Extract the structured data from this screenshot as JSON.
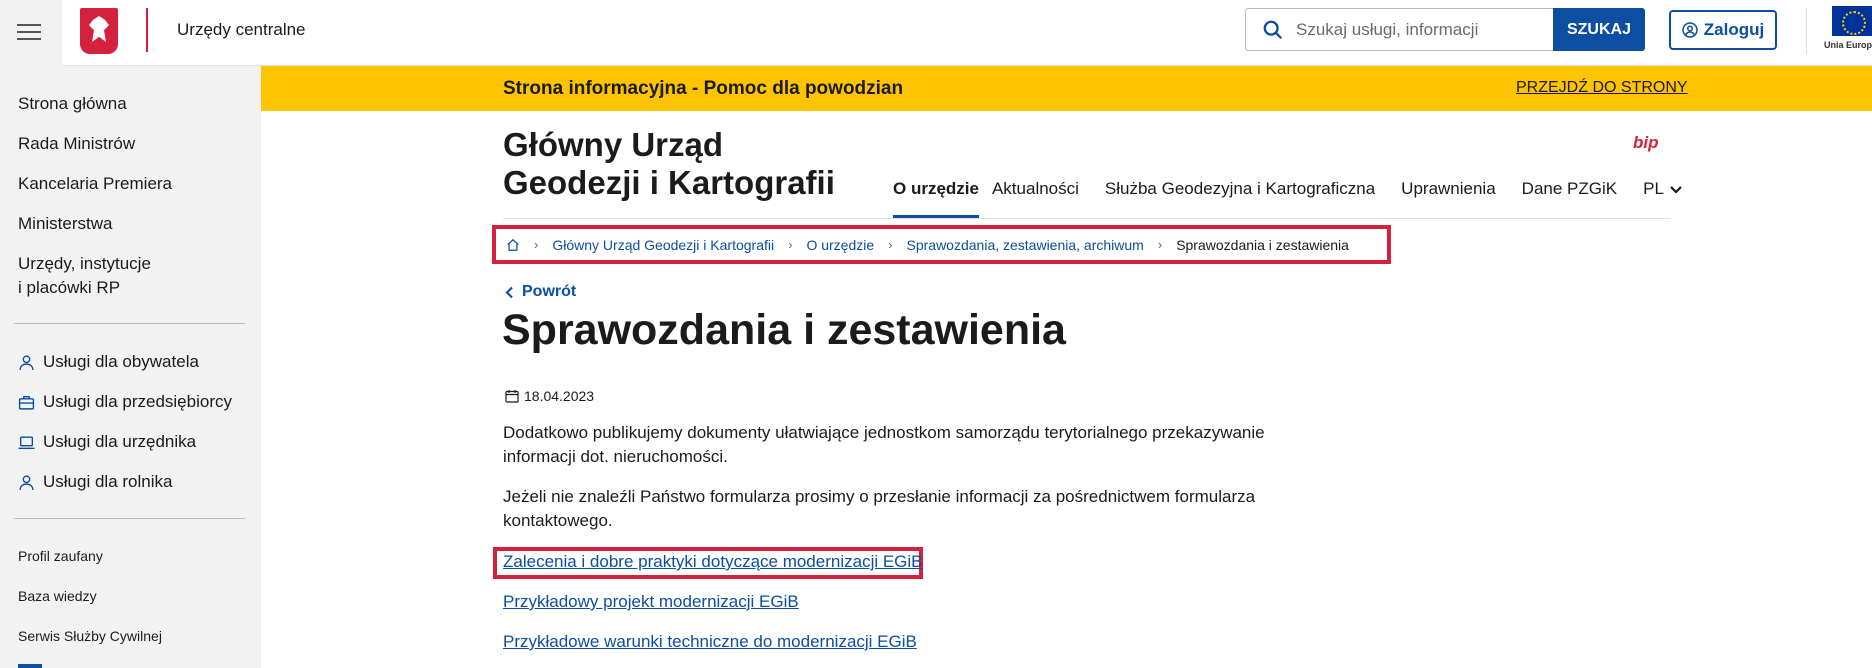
{
  "header": {
    "site_name": "Urzędy centralne",
    "search_placeholder": "Szukaj usługi, informacji",
    "search_button": "SZUKAJ",
    "login_button": "Zaloguj",
    "eu_label": "Unia Europ"
  },
  "sidebar": {
    "main_items": [
      "Strona główna",
      "Rada Ministrów",
      "Kancelaria Premiera",
      "Ministerstwa",
      "Urzędy, instytucje",
      "i placówki RP"
    ],
    "service_items": [
      {
        "label": "Usługi dla obywatela",
        "icon": "person-icon"
      },
      {
        "label": "Usługi dla przedsiębiorcy",
        "icon": "briefcase-icon"
      },
      {
        "label": "Usługi dla urzędnika",
        "icon": "laptop-icon"
      },
      {
        "label": "Usługi dla rolnika",
        "icon": "person-icon"
      }
    ],
    "small_items": [
      "Profil zaufany",
      "Baza wiedzy",
      "Serwis Służby Cywilnej"
    ]
  },
  "banner": {
    "text": "Strona informacyjna - Pomoc dla powodzian",
    "link": "PRZEJDŹ DO STRONY"
  },
  "institution": {
    "name_line1": "Główny Urząd",
    "name_line2": "Geodezji i Kartografii",
    "bip": "bip"
  },
  "nav": {
    "items": [
      "O urzędzie",
      "Aktualności",
      "Służba Geodezyjna i Kartograficzna",
      "Uprawnienia",
      "Dane PZGiK",
      "PL"
    ]
  },
  "breadcrumb": {
    "links": [
      "Główny Urząd Geodezji i Kartografii",
      "O urzędzie",
      "Sprawozdania, zestawienia, archiwum"
    ],
    "current": "Sprawozdania i zestawienia"
  },
  "content": {
    "back": "Powrót",
    "title": "Sprawozdania i zestawienia",
    "date": "18.04.2023",
    "para1": "Dodatkowo publikujemy dokumenty ułatwiające jednostkom samorządu terytorialnego przekazywanie informacji dot. nieruchomości.",
    "para2": "Jeżeli nie znaleźli Państwo formularza prosimy o przesłanie informacji za pośrednictwem formularza kontaktowego.",
    "links": [
      "Zalecenia i dobre praktyki dotyczące modernizacji EGiB",
      "Przykładowy projekt modernizacji EGiB",
      "Przykładowe warunki techniczne do modernizacji EGiB"
    ]
  },
  "colors": {
    "accent": "#0b4ea2",
    "banner": "#ffc400",
    "red": "#d4213d"
  }
}
